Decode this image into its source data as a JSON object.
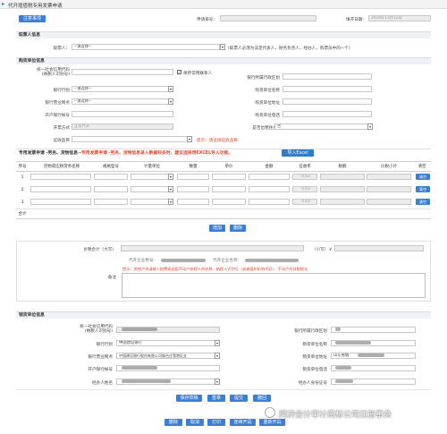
{
  "title_bar": {
    "title": "代开增值税专用发票申请"
  },
  "top": {
    "notice_button": "注意事项",
    "apply_no_label": "申请单号：",
    "fill_date_label": "填开日期：",
    "fill_date_value": "2018年11月12日"
  },
  "taker": {
    "section": "取票人信息",
    "label": "取票人：",
    "select_value": "--请选择--",
    "note": "(取票人必须为法定代表人，财务负责人，经办人，购票员中的一个)"
  },
  "buyer": {
    "section": "购货单位信息",
    "credit_code_label": "统一社会信用代码\n(纳税人识别号)",
    "save_contact": "保存常用联系人",
    "bank_region_label": "银行所属行政区划",
    "bank_label": "银行行别",
    "bank_value": "--请选择--",
    "name_label": "购货单位名称",
    "branch_label": "银行营业网点",
    "branch_value": "--请选择--",
    "addr_label": "购货单位地址",
    "account_label": "开户银行帐号",
    "phone_label": "购货单位电话",
    "method_label": "开票方式",
    "method_value": "正常代开",
    "resale_label": "是否出租住房",
    "resale_value": "否",
    "tax_item_label": "征收品目",
    "tax_item_hint": "提示：请选择征收品目"
  },
  "goods": {
    "section": "专用发票申请 -劳务、货物信息",
    "section_hint": "--专用发票申请 -劳务、货物信息录入数据较多时，建议选择用EXCEL导入功能。",
    "import_button": "导入Excel",
    "headers": [
      "序号",
      "货物或应税劳务名称",
      "规格型号",
      "计量单位",
      "数量",
      "单价",
      "金额",
      "征收率",
      "税额",
      "价税小计",
      "清空"
    ],
    "rows": [
      {
        "no": "1",
        "rate": "0.03",
        "clear": "清空"
      },
      {
        "no": "2",
        "rate": "0.03",
        "clear": "清空"
      },
      {
        "no": "3",
        "rate": "0.03",
        "clear": "清空"
      }
    ],
    "total_label": "合计",
    "add_button": "增加",
    "delete_button": "删除"
  },
  "summary": {
    "total_label": "价税合计（大写）",
    "small_label": "（小写）￥",
    "taxpayer_label": "代开企业税号：",
    "taxpayer_name_label": "代开企业名称：",
    "remark_label": "备注",
    "remark_hint": "提示：房地产申请输入纳费或出租不动产纳税人的名称、纳税人识别号（或者组织机构代码）、不动产的详细地址"
  },
  "seller": {
    "section": "销货单位信息",
    "credit_code_label": "统一社会信用代码\n(纳税人识别号)",
    "bank_region_label": "银行所属行政区划",
    "bank_label": "银行行别",
    "bank_value": "中国建设银行",
    "name_label": "销货单位名称",
    "branch_label": "银行营业网点",
    "branch_value": "中国建设银行股份有限公司烟台庄我港区支",
    "addr_label": "销货单位地址",
    "addr_value": "山东省烟",
    "account_label": "开户银行帐号",
    "phone_label": "销货单位电话",
    "agent_label": "经办人姓名",
    "agent_id_label": "经办人身份证号"
  },
  "actions": {
    "row1": [
      "保存草稿",
      "签章",
      "提交",
      "撤回"
    ],
    "row2": [
      "删除",
      "取消",
      "打印",
      "连续开具",
      "重新开具"
    ]
  },
  "watermark": "同济会计审计商标公司注册事务"
}
